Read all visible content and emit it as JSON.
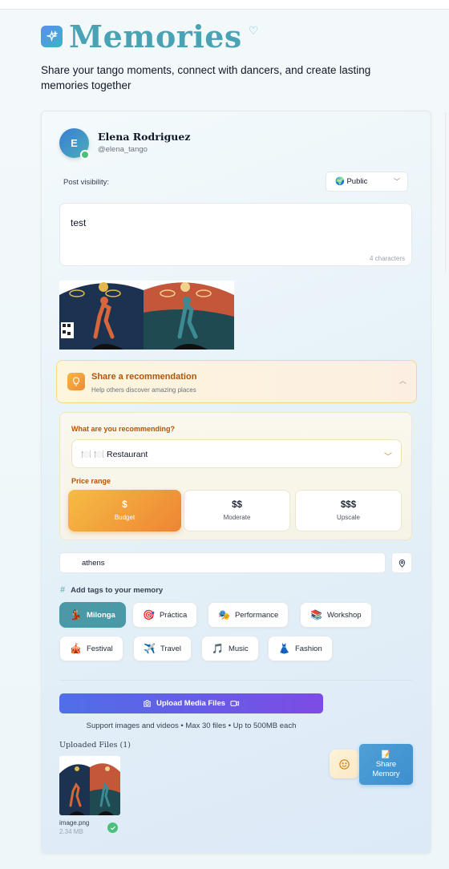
{
  "header": {
    "title": "Memories",
    "subtitle": "Share your tango moments, connect with dancers, and create lasting memories together"
  },
  "user": {
    "initial": "E",
    "name": "Elena Rodriguez",
    "handle": "@elena_tango"
  },
  "visibility": {
    "label": "Post visibility:",
    "selected": "🌍 Public"
  },
  "post": {
    "text": "test",
    "char_count": "4 characters"
  },
  "recommendation": {
    "title": "Share a recommendation",
    "subtitle": "Help others discover amazing places",
    "question": "What are you recommending?",
    "selected_type": "🍽️ 🍽️ Restaurant",
    "price_label": "Price range",
    "prices": [
      {
        "symbol": "$",
        "label": "Budget"
      },
      {
        "symbol": "$$",
        "label": "Moderate"
      },
      {
        "symbol": "$$$",
        "label": "Upscale"
      }
    ]
  },
  "location": {
    "value": "athens"
  },
  "tags": {
    "label": "Add tags to your memory",
    "items": [
      {
        "icon": "💃",
        "label": "Milonga"
      },
      {
        "icon": "🎯",
        "label": "Práctica"
      },
      {
        "icon": "🎭",
        "label": "Performance"
      },
      {
        "icon": "📚",
        "label": "Workshop"
      },
      {
        "icon": "🎪",
        "label": "Festival"
      },
      {
        "icon": "✈️",
        "label": "Travel"
      },
      {
        "icon": "🎵",
        "label": "Music"
      },
      {
        "icon": "👗",
        "label": "Fashion"
      }
    ]
  },
  "upload": {
    "button_label": "Upload Media Files",
    "note": "Support images and videos • Max 30 files • Up to 500MB each",
    "uploaded_label": "Uploaded Files (1)",
    "file_name": "image.png",
    "file_size": "2.34 MB"
  },
  "share": {
    "icon": "📝",
    "label_line1": "Share",
    "label_line2": "Memory"
  },
  "colors": {
    "accent": "#4aa3b4",
    "tag_active": "#4a99a6",
    "rec_accent": "#b4530a",
    "upload_start": "#4f6fe8",
    "upload_end": "#7d4be4"
  }
}
